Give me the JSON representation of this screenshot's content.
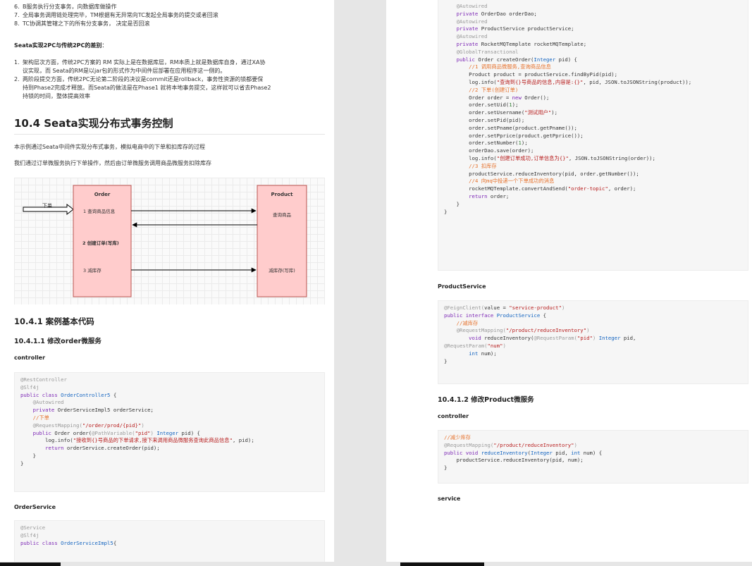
{
  "left": {
    "steps": [
      {
        "num": "6.",
        "text": "B服务执行分支事务，向数据库做操作"
      },
      {
        "num": "7.",
        "text": "全局事务调用链处理完毕，TM根据有无异常向TC发起全局事务的提交或者回滚"
      },
      {
        "num": "8.",
        "text": "TC协调其管辖之下的所有分支事务， 决定是否回滚"
      }
    ],
    "diff_heading_bold": "Seata实现2PC与传统2PC的差别",
    "diff_heading_colon": "：",
    "diff_items": [
      {
        "num": "1.",
        "lines": [
          "架构层次方面，传统2PC方案的 RM 实际上是在数据库层，RM本质上就是数据库自身，通过XA协",
          "议实现，而 Seata的RM是以jar包的形式作为中间件层部署在应用程序这一侧的。"
        ]
      },
      {
        "num": "2.",
        "lines": [
          "两阶段提交方面，传统2PC无论第二阶段的决议是commit还是rollback，事务性资源的锁都要保",
          "持到Phase2完成才释放。而Seata的做法是在Phase1 就将本地事务提交，这样就可以省去Phase2",
          "持锁的时间，整体提高效率"
        ]
      }
    ],
    "section_title": "10.4 Seata实现分布式事务控制",
    "para1": "本示例通过Seata中间件实现分布式事务，模拟电商中的下单和扣库存的过程",
    "para2": "我们通过订单微服务执行下单操作，然后由订单微服务调用商品微服务扣除库存",
    "diagram": {
      "order_title": "Order",
      "product_title": "Product",
      "input_label": "下单",
      "step1": "1 查询商品信息",
      "step2": "2 创建订单(写库)",
      "step3": "3 减库存",
      "product_step1": "查询商品",
      "product_step3": "减库存(写库)"
    },
    "h3_basic": "10.4.1 案例基本代码",
    "h4_order": "10.4.1.1 修改order微服务",
    "controller_label": "controller",
    "orderservice_label": "OrderService"
  },
  "right": {
    "productservice_label": "ProductService",
    "h4_product": "10.4.1.2 修改Product微服务",
    "controller_label": "controller",
    "service_label": "service"
  },
  "colors": {
    "box_fill": "#ffcccc",
    "box_stroke": "#b85450",
    "keyword": "#7c27b5",
    "type": "#1565c0",
    "string": "#b71c1c",
    "comment": "#e6732e"
  }
}
